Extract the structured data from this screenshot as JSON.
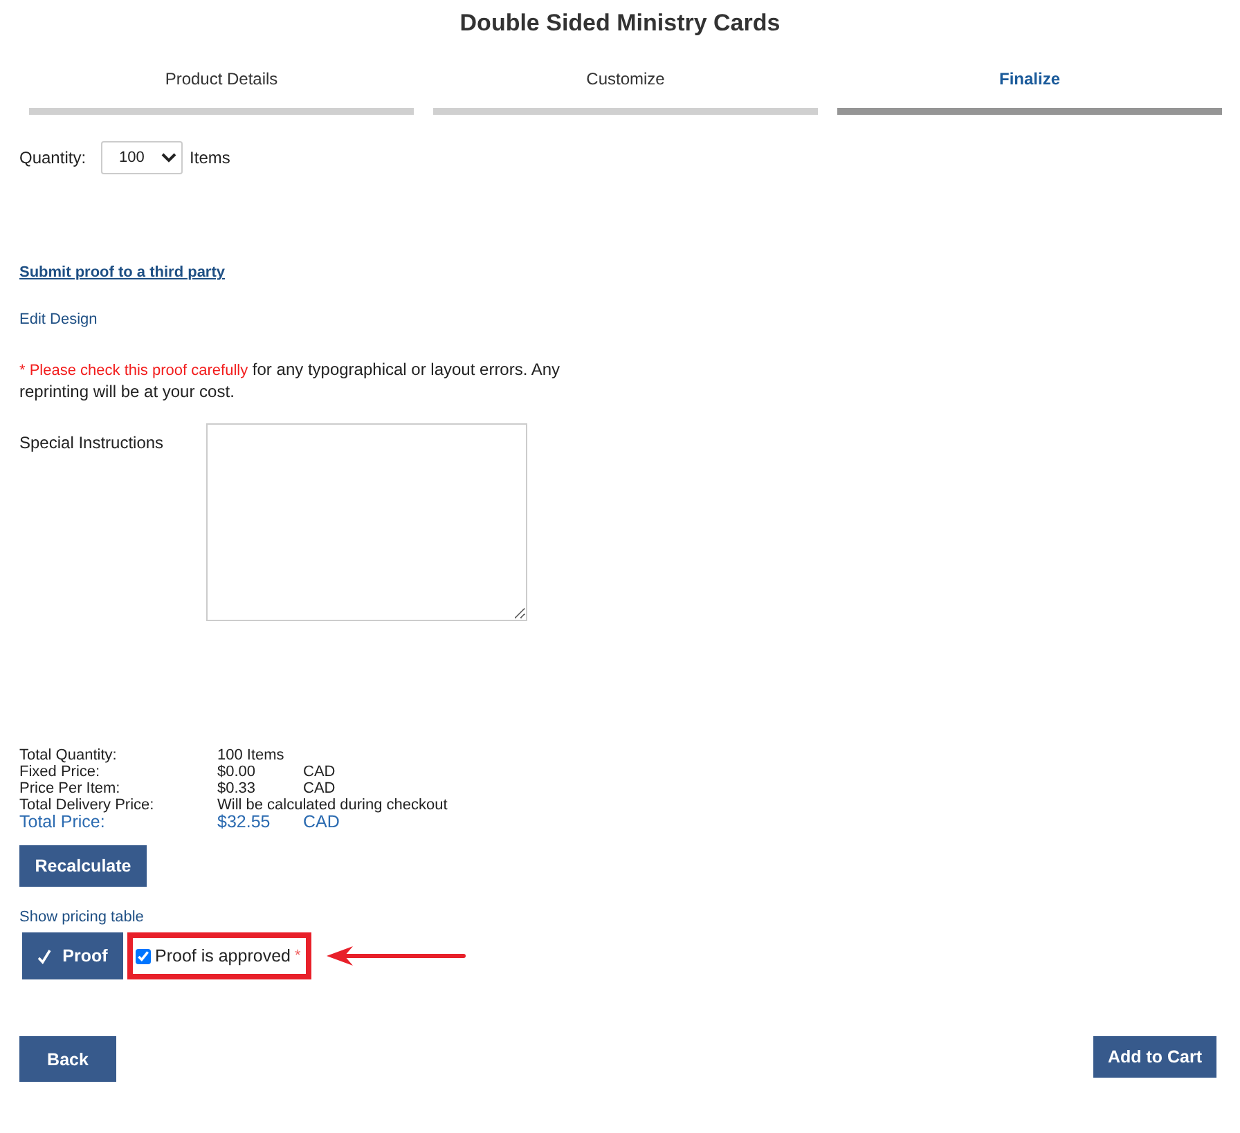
{
  "title": "Double Sided Ministry Cards",
  "steps": [
    {
      "label": "Product Details",
      "selected": false
    },
    {
      "label": "Customize",
      "selected": false
    },
    {
      "label": "Finalize",
      "selected": true
    }
  ],
  "quantity": {
    "label": "Quantity:",
    "value": "100",
    "unit": "Items"
  },
  "links": {
    "submit_proof": "Submit proof to a third party",
    "edit_design": "Edit Design"
  },
  "notice": {
    "warning": "* Please check this proof carefully",
    "text": " for any typographical or layout errors. Any reprinting will be at your cost."
  },
  "special_instructions": {
    "label": "Special Instructions"
  },
  "pricing": [
    {
      "label": "Total Quantity:",
      "value": "100 Items",
      "kind": "normal"
    },
    {
      "label": "Fixed Price:",
      "value": "$0.00",
      "currency": "CAD",
      "kind": "normal"
    },
    {
      "label": "Price Per Item:",
      "value": "$0.33",
      "currency": "CAD",
      "kind": "normal"
    },
    {
      "label": "Total Delivery Price:",
      "value": "Will be calculated during checkout",
      "kind": "normal"
    },
    {
      "label": "Total Price:",
      "value": "$32.55",
      "currency": "CAD",
      "kind": "total"
    }
  ],
  "recalculate_button": "Recalculate",
  "show_pricing_table": "Show pricing table",
  "proof_button": "Proof",
  "approval": {
    "label": "Proof is approved",
    "required_mark": "*",
    "checked": true
  },
  "back_button": "Back",
  "add_to_cart_button": "Add to Cart"
}
